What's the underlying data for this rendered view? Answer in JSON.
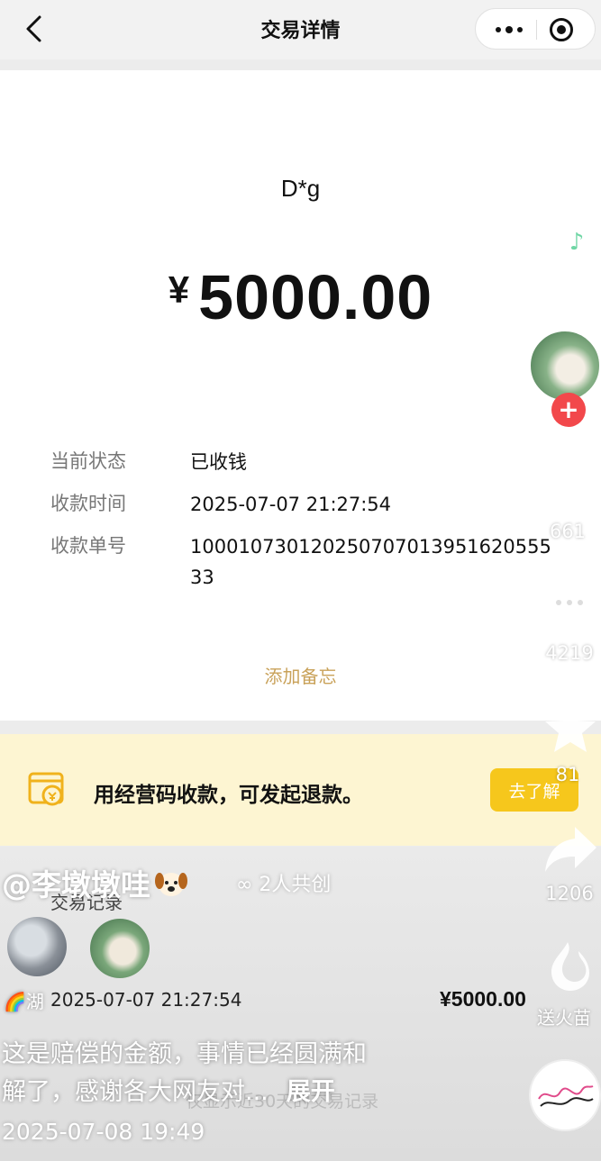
{
  "nav": {
    "back_icon": "chevron-left-icon",
    "title": "交易详情",
    "more_icon": "more-dots-icon",
    "close_icon": "target-circle-icon"
  },
  "transaction": {
    "payer": "D*g",
    "currency": "¥",
    "amount": "5000.00",
    "details": [
      {
        "label": "当前状态",
        "value": "已收钱"
      },
      {
        "label": "收款时间",
        "value": "2025-07-07 21:27:54"
      },
      {
        "label": "收款单号",
        "value": "100010730120250707013951620555 33"
      }
    ],
    "add_note": "添加备忘"
  },
  "banner": {
    "icon": "store-qr-icon",
    "text": "用经营码收款，可发起退款。",
    "button": "去了解",
    "accent": "#f6c71c"
  },
  "records": {
    "title": "交易记录",
    "date": "2025-07-07 21:27:54",
    "amount": "¥5000.00",
    "footer": "仅显示近30天的交易记录"
  },
  "video_overlay": {
    "username": "@李墩墩哇",
    "cocreate": "∞ 2人共创",
    "lake_prefix": "🌈湖",
    "caption_line1": "这是赔偿的金额，事情已经圆满和",
    "caption_line2": "解了，感谢各大网友对...",
    "expand": "展开",
    "post_time": "2025-07-08 19:49"
  },
  "right_rail": {
    "music_icon": "music-note-icon",
    "follow_icon": "plus-icon",
    "like_count": "661",
    "comment_count": "4219",
    "star_count": "81",
    "share_count": "1206",
    "fire_label": "送火苗",
    "accent_red": "#f2484b"
  }
}
